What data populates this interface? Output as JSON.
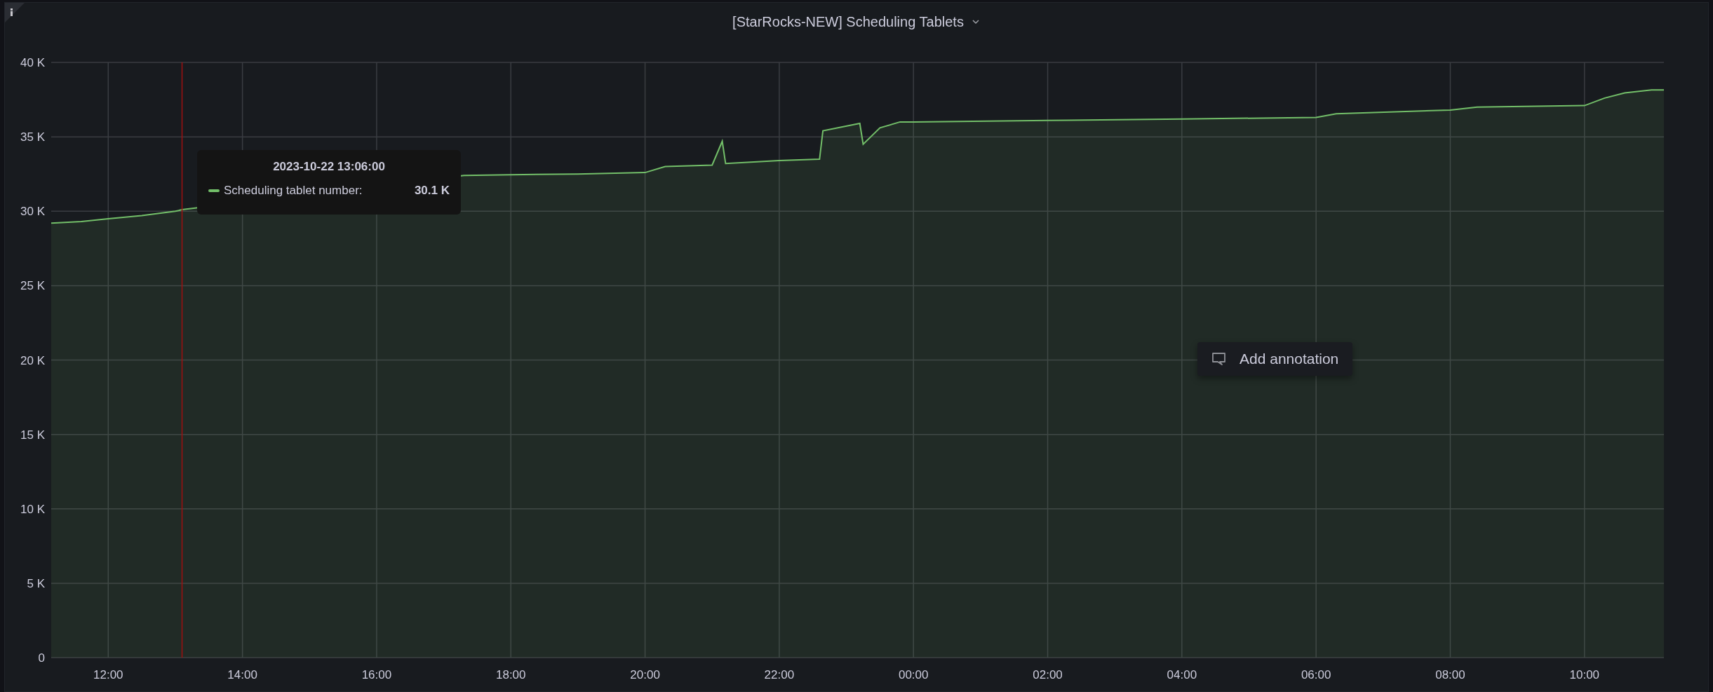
{
  "panel": {
    "title": "[StarRocks-NEW] Scheduling Tablets"
  },
  "chart_data": {
    "type": "area",
    "grid": true,
    "xlim": [
      "2023-10-22T11:09",
      "2023-10-23T11:11"
    ],
    "ylim": [
      0,
      40000
    ],
    "xticks": [
      {
        "value": "2023-10-22T12:00",
        "label": "12:00"
      },
      {
        "value": "2023-10-22T14:00",
        "label": "14:00"
      },
      {
        "value": "2023-10-22T16:00",
        "label": "16:00"
      },
      {
        "value": "2023-10-22T18:00",
        "label": "18:00"
      },
      {
        "value": "2023-10-22T20:00",
        "label": "20:00"
      },
      {
        "value": "2023-10-22T22:00",
        "label": "22:00"
      },
      {
        "value": "2023-10-23T00:00",
        "label": "00:00"
      },
      {
        "value": "2023-10-23T02:00",
        "label": "02:00"
      },
      {
        "value": "2023-10-23T04:00",
        "label": "04:00"
      },
      {
        "value": "2023-10-23T06:00",
        "label": "06:00"
      },
      {
        "value": "2023-10-23T08:00",
        "label": "08:00"
      },
      {
        "value": "2023-10-23T10:00",
        "label": "10:00"
      }
    ],
    "yticks": [
      {
        "value": 0,
        "label": "0"
      },
      {
        "value": 5000,
        "label": "5 K"
      },
      {
        "value": 10000,
        "label": "10 K"
      },
      {
        "value": 15000,
        "label": "15 K"
      },
      {
        "value": 20000,
        "label": "20 K"
      },
      {
        "value": 25000,
        "label": "25 K"
      },
      {
        "value": 30000,
        "label": "30 K"
      },
      {
        "value": 35000,
        "label": "35 K"
      },
      {
        "value": 40000,
        "label": "40 K"
      }
    ],
    "x": [
      "2023-10-22T11:09",
      "2023-10-22T11:36",
      "2023-10-22T12:00",
      "2023-10-22T12:30",
      "2023-10-22T13:00",
      "2023-10-22T13:06",
      "2023-10-22T17:18",
      "2023-10-22T18:00",
      "2023-10-22T19:00",
      "2023-10-22T20:00",
      "2023-10-22T20:18",
      "2023-10-22T21:00",
      "2023-10-22T21:09",
      "2023-10-22T21:12",
      "2023-10-22T22:00",
      "2023-10-22T22:36",
      "2023-10-22T22:39",
      "2023-10-22T23:12",
      "2023-10-22T23:15",
      "2023-10-22T23:30",
      "2023-10-22T23:48",
      "2023-10-23T00:00",
      "2023-10-23T02:00",
      "2023-10-23T04:00",
      "2023-10-23T06:00",
      "2023-10-23T06:18",
      "2023-10-23T08:00",
      "2023-10-23T08:24",
      "2023-10-23T10:00",
      "2023-10-23T10:18",
      "2023-10-23T10:36",
      "2023-10-23T11:00",
      "2023-10-23T11:11"
    ],
    "series": [
      {
        "color": "#73bf69",
        "values": [
          29200,
          29300,
          29500,
          29700,
          30000,
          30100,
          32400,
          32450,
          32500,
          32600,
          33000,
          33100,
          34700,
          33200,
          33400,
          33500,
          35400,
          35900,
          34500,
          35600,
          36000,
          36000,
          36100,
          36200,
          36300,
          36550,
          36800,
          37000,
          37100,
          37600,
          37950,
          38150,
          38150
        ]
      }
    ],
    "ref_lines": [
      {
        "axis": "x",
        "value": "2023-10-22T13:06"
      }
    ]
  },
  "tooltip": {
    "time": "2023-10-22 13:06:00",
    "series_name": "Scheduling tablet number:",
    "value": "30.1 K"
  },
  "context_menu": {
    "label": "Add annotation"
  }
}
